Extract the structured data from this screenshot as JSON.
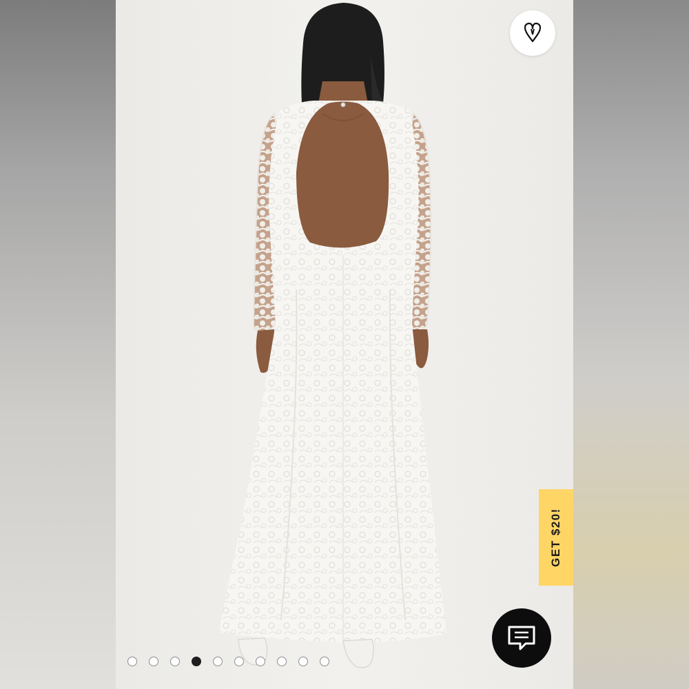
{
  "wishlist": {
    "icon": "heart-icon"
  },
  "promo": {
    "label": "GET $20!",
    "color": "#ffd566"
  },
  "chat": {
    "icon": "chat-bubble-icon",
    "color": "#0d0d0d"
  },
  "carousel": {
    "count": 10,
    "active_index": 3
  },
  "colors": {
    "photo_background": "#eeedea",
    "dress": "#f7f6f3",
    "skin": "#8a5b3e",
    "hair": "#1d1d1d"
  }
}
